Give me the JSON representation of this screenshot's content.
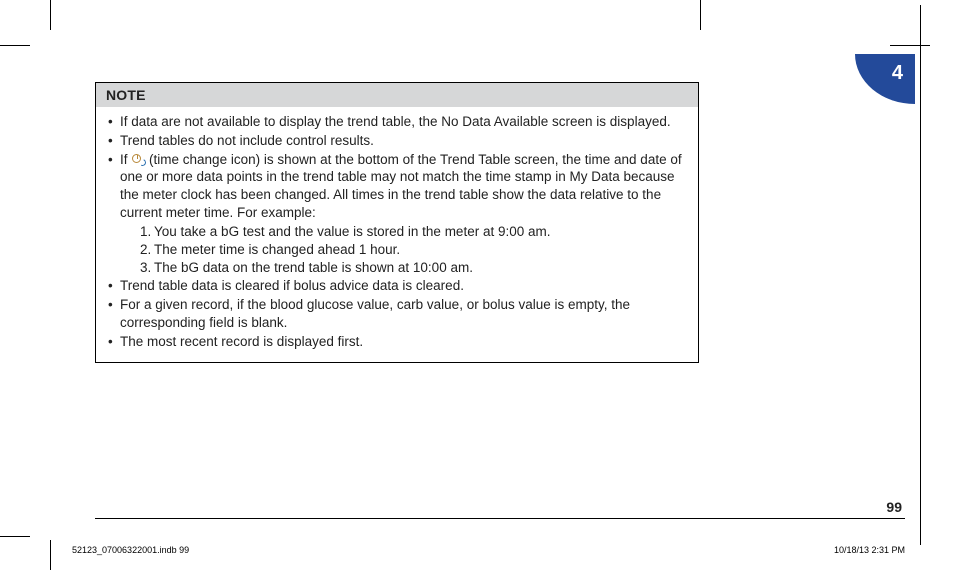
{
  "chapter": "4",
  "note": {
    "header": "NOTE",
    "bullets": {
      "b1": "If data are not available to display the trend table, the No Data Available screen is displayed.",
      "b2": "Trend tables do not include control results.",
      "b3_pre": "If ",
      "b3_post": " (time change icon) is shown at the bottom of the Trend Table screen, the time and date of one or more data points in the trend table may not match the time stamp in My Data because the meter clock has been changed. All times in the trend table show the data relative to the current meter time. For example:",
      "b3_steps": {
        "s1": "You take a bG test and the value is stored in the meter at 9:00 am.",
        "s2": "The meter time is changed ahead 1 hour.",
        "s3": "The bG data on the trend table is shown at 10:00 am."
      },
      "b4": "Trend table data is cleared if bolus advice data is cleared.",
      "b5": "For a given record, if the blood glucose value, carb value, or bolus value is empty, the corresponding field is blank.",
      "b6": "The most recent record is displayed first."
    }
  },
  "page_number": "99",
  "footer": {
    "left": "52123_07006322001.indb   99",
    "right": "10/18/13   2:31 PM"
  }
}
